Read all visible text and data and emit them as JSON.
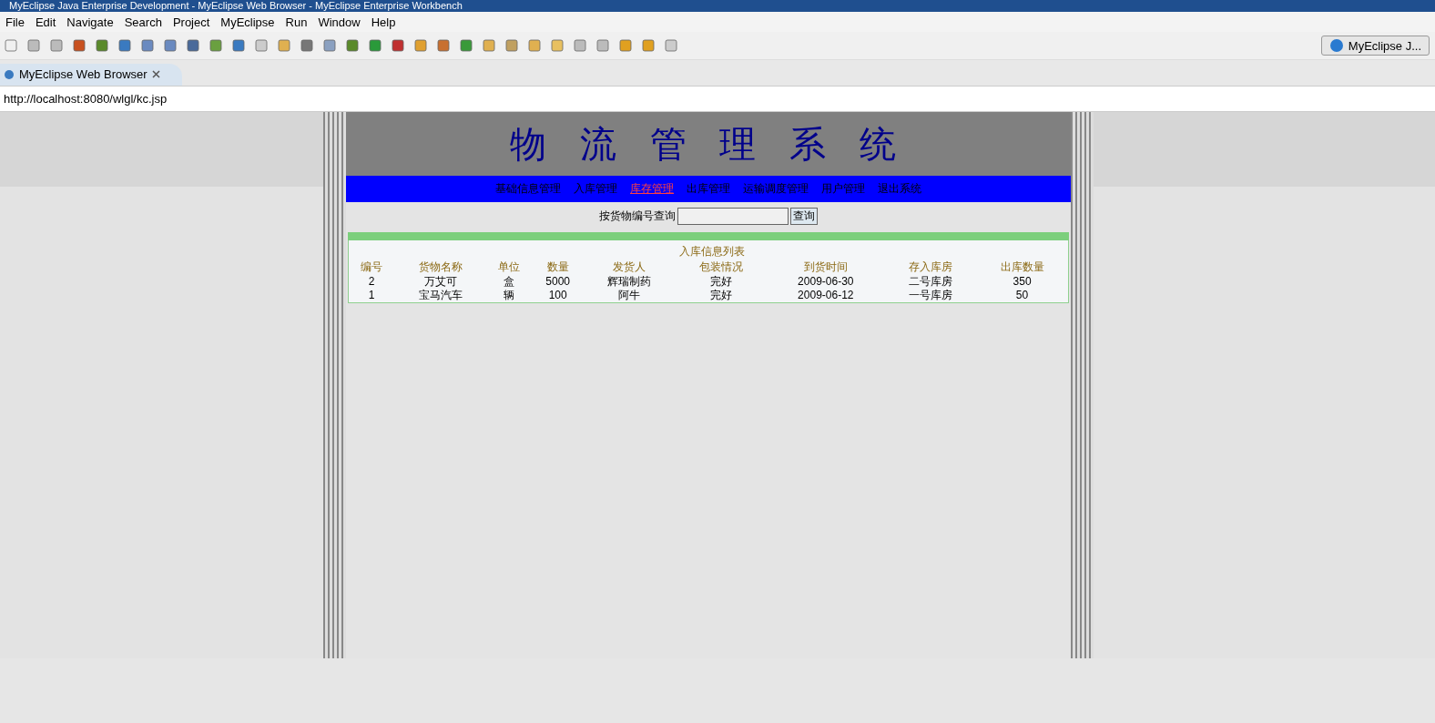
{
  "window": {
    "title": "MyEclipse Java Enterprise Development - MyEclipse Web Browser - MyEclipse Enterprise Workbench"
  },
  "menu": [
    "File",
    "Edit",
    "Navigate",
    "Search",
    "Project",
    "MyEclipse",
    "Run",
    "Window",
    "Help"
  ],
  "perspective": {
    "label": "MyEclipse J..."
  },
  "editor_tab": {
    "label": "MyEclipse Web Browser",
    "selected": true
  },
  "address": {
    "value": "http://localhost:8080/wlgl/kc.jsp"
  },
  "page": {
    "title": "物 流 管 理 系 统",
    "nav": [
      {
        "label": "基础信息管理",
        "selected": false
      },
      {
        "label": "入库管理",
        "selected": false
      },
      {
        "label": "库存管理",
        "selected": true
      },
      {
        "label": "出库管理",
        "selected": false
      },
      {
        "label": "运输调度管理",
        "selected": false
      },
      {
        "label": "用户管理",
        "selected": false
      },
      {
        "label": "退出系统",
        "selected": false
      }
    ],
    "search": {
      "label": "按货物编号查询",
      "button": "查询"
    },
    "table": {
      "caption": "入库信息列表",
      "columns": [
        "编号",
        "货物名称",
        "单位",
        "数量",
        "发货人",
        "包装情况",
        "到货时间",
        "存入库房",
        "出库数量"
      ],
      "rows": [
        [
          "2",
          "万艾可",
          "盒",
          "5000",
          "辉瑞制药",
          "完好",
          "2009-06-30",
          "二号库房",
          "350"
        ],
        [
          "1",
          "宝马汽车",
          "辆",
          "100",
          "阿牛",
          "完好",
          "2009-06-12",
          "一号库房",
          "50"
        ]
      ]
    }
  }
}
